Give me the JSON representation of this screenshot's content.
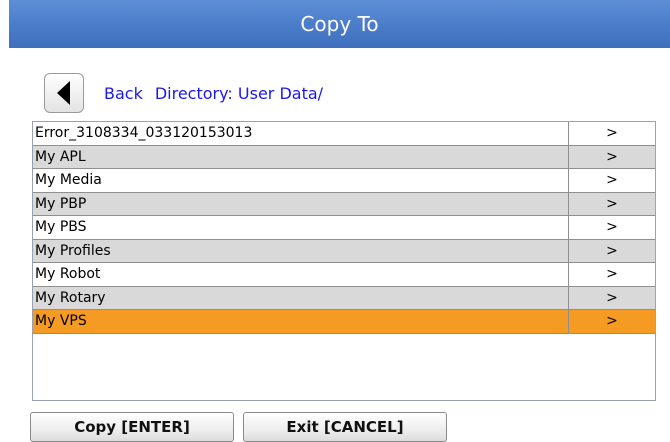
{
  "window": {
    "title": "Copy To"
  },
  "nav": {
    "back_icon": "triangle-left-icon",
    "back_label": "Back",
    "directory_label": "Directory: User Data/"
  },
  "file_list": {
    "rows": [
      {
        "name": "Error_3108334_033120153013",
        "arrow": ">"
      },
      {
        "name": "My APL",
        "arrow": ">"
      },
      {
        "name": "My Media",
        "arrow": ">"
      },
      {
        "name": "My PBP",
        "arrow": ">"
      },
      {
        "name": "My PBS",
        "arrow": ">"
      },
      {
        "name": "My Profiles",
        "arrow": ">"
      },
      {
        "name": "My Robot",
        "arrow": ">"
      },
      {
        "name": "My Rotary",
        "arrow": ">"
      },
      {
        "name": "My VPS",
        "arrow": ">"
      }
    ],
    "selected_index": 8
  },
  "buttons": {
    "copy_label": "Copy [ENTER]",
    "exit_label": "Exit [CANCEL]"
  },
  "colors": {
    "title_bar": "#4a7cc9",
    "link_text": "#1a1aee",
    "row_alt": "#d9d9d9",
    "row_selected": "#f59a23"
  }
}
